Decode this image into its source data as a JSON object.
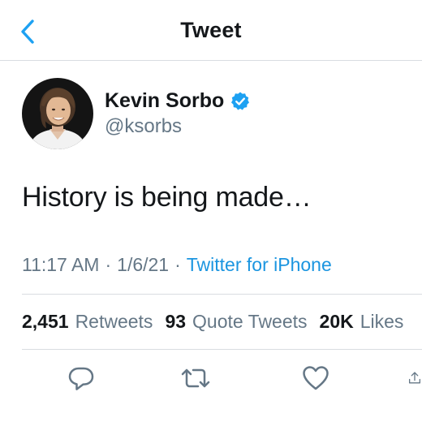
{
  "nav": {
    "title": "Tweet",
    "back_icon": "chevron-left-icon",
    "accent_color": "#1da1f2"
  },
  "author": {
    "display_name": "Kevin Sorbo",
    "handle": "@ksorbs",
    "verified_icon": "verified-badge-icon",
    "verified_color": "#1da1f2"
  },
  "tweet": {
    "text": "History is being made…",
    "time": "11:17 AM",
    "date": "1/6/21",
    "separator": "·",
    "source": "Twitter for iPhone"
  },
  "stats": {
    "retweets_count": "2,451",
    "retweets_label": "Retweets",
    "quote_tweets_count": "93",
    "quote_tweets_label": "Quote Tweets",
    "likes_count": "20K",
    "likes_label": "Likes"
  },
  "actions": {
    "reply_icon": "reply-icon",
    "retweet_icon": "retweet-icon",
    "like_icon": "heart-icon",
    "share_icon": "share-icon",
    "icon_color": "#657786"
  },
  "colors": {
    "text_primary": "#14171a",
    "text_secondary": "#657786",
    "link": "#1b95e0",
    "divider": "#d9dde1"
  }
}
